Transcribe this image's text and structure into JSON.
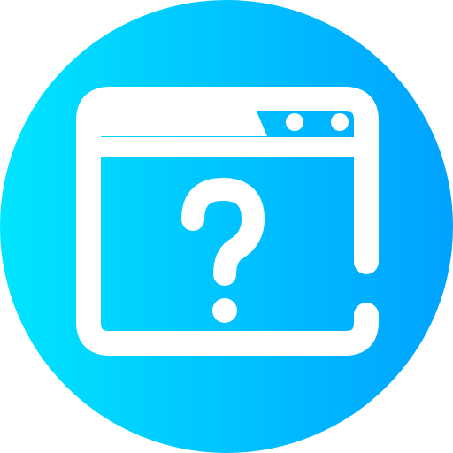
{
  "icon": {
    "name": "browser-window-question-icon",
    "gradient_start": "#00E5FF",
    "gradient_end": "#00A2FF",
    "stroke_color": "#FFFFFF"
  }
}
